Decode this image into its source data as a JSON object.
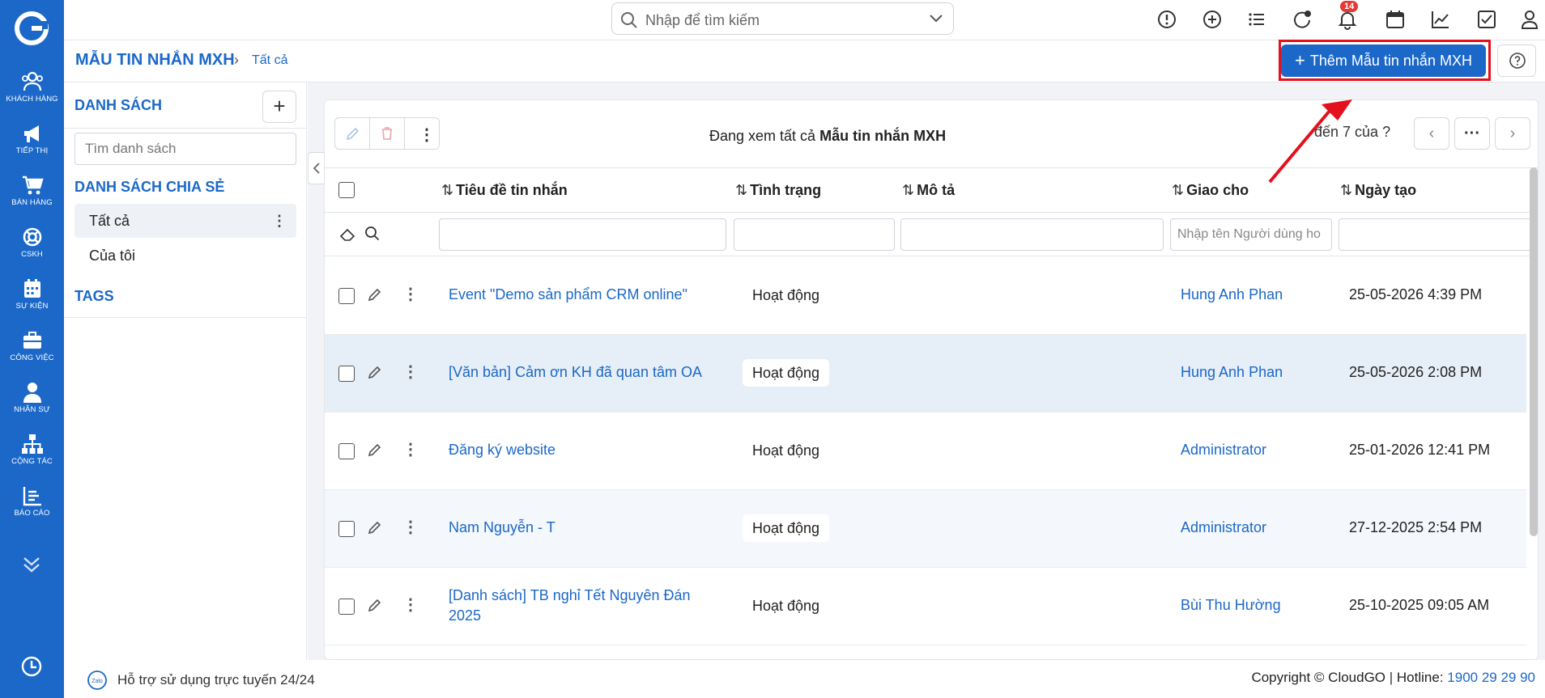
{
  "nav": {
    "items": [
      {
        "label": "KHÁCH HÀNG",
        "icon": "users-icon"
      },
      {
        "label": "TIẾP THỊ",
        "icon": "megaphone-icon"
      },
      {
        "label": "BÁN HÀNG",
        "icon": "cart-icon"
      },
      {
        "label": "CSKH",
        "icon": "lifebuoy-icon"
      },
      {
        "label": "SỰ KIỆN",
        "icon": "calendar-icon"
      },
      {
        "label": "CÔNG VIỆC",
        "icon": "briefcase-icon"
      },
      {
        "label": "NHÂN SỰ",
        "icon": "person-icon"
      },
      {
        "label": "CỘNG TÁC",
        "icon": "org-chart-icon"
      },
      {
        "label": "BÁO CÁO",
        "icon": "report-icon"
      }
    ]
  },
  "topbar": {
    "search_placeholder": "Nhập để tìm kiếm",
    "notification_count": "14"
  },
  "header": {
    "title": "MẪU TIN NHẮN MXH",
    "breadcrumb": "Tất cả",
    "add_button": "Thêm Mẫu tin nhắn MXH"
  },
  "sidebar": {
    "list_title": "DANH SÁCH",
    "search_placeholder": "Tìm danh sách",
    "shared_title": "DANH SÁCH CHIA SẺ",
    "items": [
      {
        "label": "Tất cả"
      },
      {
        "label": "Của tôi"
      }
    ],
    "tags_title": "TAGS"
  },
  "table": {
    "viewing_prefix": "Đang xem tất cả",
    "viewing_module": "Mẫu tin nhắn MXH",
    "page_info": "đến 7 của",
    "page_unknown": "?",
    "columns": [
      "Tiêu đề tin nhắn",
      "Tình trạng",
      "Mô tả",
      "Giao cho",
      "Ngày tạo"
    ],
    "assignee_filter_placeholder": "Nhập tên Người dùng ho",
    "rows": [
      {
        "title": "Event \"Demo sản phẩm CRM online\"",
        "title_line2": "",
        "status": "Hoạt động",
        "description": "",
        "assignee": "Hung Anh Phan",
        "created": "25-05-2026 4:39 PM"
      },
      {
        "title": "[Văn bản] Cảm ơn KH đã quan tâm OA",
        "title_line2": "",
        "status": "Hoạt động",
        "description": "",
        "assignee": "Hung Anh Phan",
        "created": "25-05-2026 2:08 PM"
      },
      {
        "title": "Đăng ký website",
        "title_line2": "",
        "status": "Hoạt động",
        "description": "",
        "assignee": "Administrator",
        "created": "25-01-2026 12:41 PM"
      },
      {
        "title": "Nam Nguyễn - T",
        "title_line2": "",
        "status": "Hoạt động",
        "description": "",
        "assignee": "Administrator",
        "created": "27-12-2025 2:54 PM"
      },
      {
        "title": "[Danh sách] TB nghỉ Tết Nguyên Đán",
        "title_line2": "2025",
        "status": "Hoạt động",
        "description": "",
        "assignee": "Bùi Thu Hường",
        "created": "25-10-2025 09:05 AM"
      }
    ]
  },
  "footer": {
    "support": "Hỗ trợ sử dụng trực tuyến 24/24",
    "copyright": "Copyright © CloudGO",
    "hotline_label": "Hotline:",
    "hotline": "1900 29 29 90"
  },
  "colors": {
    "brand": "#1b68c9",
    "highlight": "#e3101d"
  }
}
